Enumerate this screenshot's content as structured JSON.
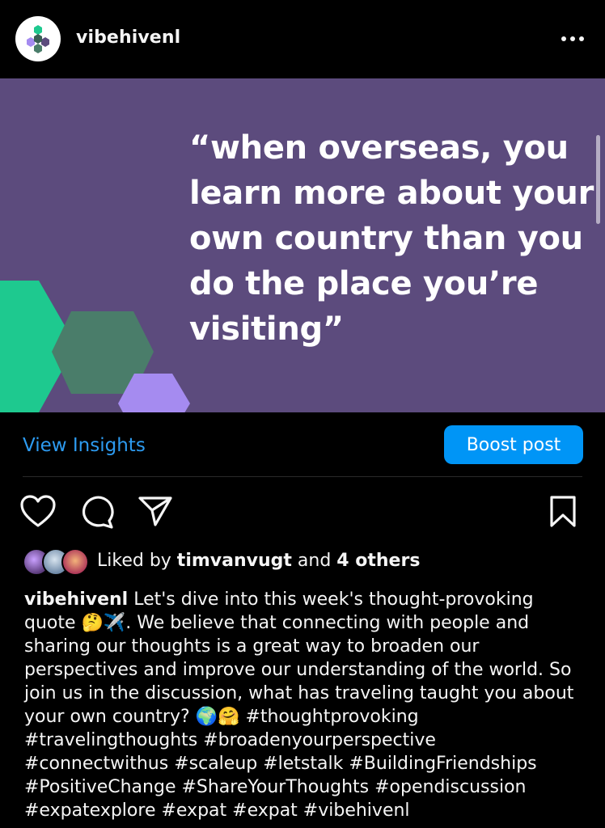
{
  "header": {
    "username": "vibehivenl",
    "more_icon": "more-horizontal-icon",
    "avatar_icon": "hexagon-logo-icon"
  },
  "post": {
    "quote": "“when overseas, you learn more about your own country than you do the place you’re visiting”",
    "background_color": "#5c4b7d",
    "hex_colors": [
      "#1ec98f",
      "#4a7d6a",
      "#a58bf0"
    ]
  },
  "insights": {
    "view_label": "View Insights",
    "boost_label": "Boost post"
  },
  "actions": {
    "like_icon": "heart-icon",
    "comment_icon": "comment-icon",
    "share_icon": "send-icon",
    "save_icon": "bookmark-icon"
  },
  "likes": {
    "prefix": "Liked by ",
    "user": "timvanvugt",
    "middle": " and ",
    "others": "4 others"
  },
  "caption": {
    "username": "vibehivenl",
    "text": " Let's dive into this week's thought-provoking quote 🤔✈️. We believe that connecting with people and sharing our thoughts is a great way to broaden our perspectives and improve our understanding of the world. So join us in the discussion, what has traveling taught you about your own country? 🌍🤗 ",
    "hashtags": "#thoughtprovoking #travelingthoughts #broadenyourperspective #connectwithus #scaleup #letstalk #BuildingFriendships #PositiveChange #ShareYourThoughts #opendiscussion #expatexplore #expat #expat #vibehivenl"
  },
  "colors": {
    "accent": "#0095f6",
    "link": "#2d9bf0",
    "background": "#000000"
  }
}
